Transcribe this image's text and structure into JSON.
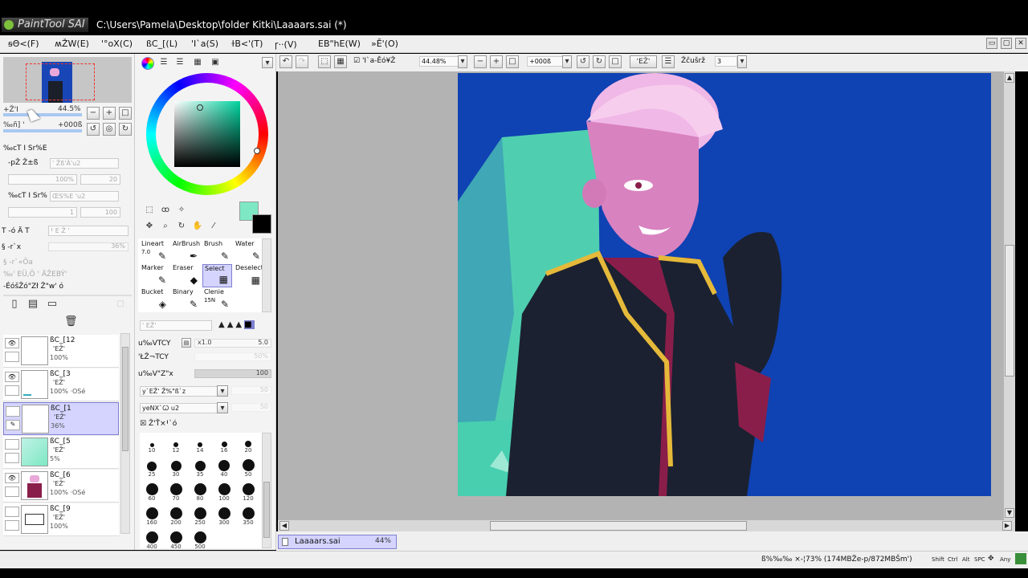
{
  "app": {
    "logo_text": "PaintTool SAI",
    "window_title": "C:\\Users\\Pamela\\Desktop\\folder Kitki\\Laaaars.sai (*)"
  },
  "menu": {
    "items": [
      "ꞩΘ<(F)",
      "ʍŽW(E)",
      "ꞌ°oX(C)",
      "ßC_[(L)",
      "ꞌI`a(S)",
      "ɫB<ꞌ(T)",
      "ꞅ··(V)",
      "EB\"hE(W)",
      "»Ӗꞌ(O)"
    ],
    "win_buttons": [
      "▭",
      "▢",
      "✕"
    ]
  },
  "navigator": {
    "zoom_label": "+ŽꞌI",
    "zoom_value": "44.5%",
    "angle_label": "‰ñ] ꞌ",
    "angle_value": "+000ß"
  },
  "layer_props": {
    "section1": "‰cT I Sr%E",
    "mode_label": "-pŽ Ž±ß",
    "mode_value": "ꞌ ŽßꞌÄꞌu2",
    "opacity_value": "100%",
    "val20": "20",
    "section2": "‰cT I Sr%",
    "mode2_value": "ŒS%E ꞌu2",
    "val1": "1",
    "val100": "100",
    "texture_label": "T -ó Ä T",
    "texture_value": "Ꞌ E Ž ꞌ",
    "tex_small": "§ -r`x",
    "tex_pct": "36%",
    "cb1": "§ -r`«Öa",
    "cb2": "‰ꞌ EÜ,Ö ꞌ ÄŽEBÝꞌ",
    "cb3": "-ÉóšŽó\"Zł Ž\"wꞌ ó"
  },
  "layers": [
    {
      "name": "ßC_[12",
      "mode": "ꞌEŽꞌ",
      "opacity": "100%",
      "visible": "true"
    },
    {
      "name": "ßC_[3",
      "mode": "ꞌEŽꞌ",
      "opacity": "100% ·OSé",
      "visible": "true"
    },
    {
      "name": "ßC_[1",
      "mode": "ꞌEŽꞌ",
      "opacity": "36%",
      "visible": "false"
    },
    {
      "name": "ßC_[5",
      "mode": "ꞌEŽꞌ",
      "opacity": "5%",
      "visible": "false"
    },
    {
      "name": "ßC_[6",
      "mode": "ꞌEŽꞌ",
      "opacity": "100% ·OSé",
      "visible": "true"
    },
    {
      "name": "ßC_[9",
      "mode": "ꞌEŽꞌ",
      "opacity": "100%",
      "visible": "false"
    }
  ],
  "colors": {
    "primary": "#7ee8c4",
    "secondary": "#000000",
    "accent": "#7f7fd0"
  },
  "tools": [
    {
      "label": "Lineart",
      "size": "7.0"
    },
    {
      "label": "AirBrush",
      "size": ""
    },
    {
      "label": "Brush",
      "size": ""
    },
    {
      "label": "Water",
      "size": ""
    },
    {
      "label": "Marker",
      "size": ""
    },
    {
      "label": "Eraser",
      "size": ""
    },
    {
      "label": "Select",
      "size": ""
    },
    {
      "label": "Deselect",
      "size": ""
    },
    {
      "label": "Bucket",
      "size": ""
    },
    {
      "label": "Binary",
      "size": ""
    },
    {
      "label": "Clenie",
      "size": "15N"
    }
  ],
  "brush_settings": {
    "mode_field": "ꞌ EŽꞌ",
    "size_label": "u‰VTCY",
    "size_mult": "x1.0",
    "size_value": "5.0",
    "min_label": "ꞌŁŽ¬TCY",
    "min_value": "50%",
    "density_label": "u‰V\"Z\"x",
    "density_value": "100",
    "shape1": "y`EŽꞌ Ž%\"ß`z",
    "shape1_val": "50",
    "shape2": "yeNX`Ꞷ u2",
    "shape2_val": "50",
    "adv_label": "ŽꞌŤ×Ꞌ`ó"
  },
  "brush_sizes": [
    {
      "s": "10",
      "d": 5
    },
    {
      "s": "12",
      "d": 6
    },
    {
      "s": "14",
      "d": 6
    },
    {
      "s": "16",
      "d": 7
    },
    {
      "s": "20",
      "d": 8
    },
    {
      "s": "25",
      "d": 12
    },
    {
      "s": "30",
      "d": 13
    },
    {
      "s": "35",
      "d": 13
    },
    {
      "s": "40",
      "d": 14
    },
    {
      "s": "50",
      "d": 15
    },
    {
      "s": "60",
      "d": 15
    },
    {
      "s": "70",
      "d": 15
    },
    {
      "s": "80",
      "d": 15
    },
    {
      "s": "100",
      "d": 15
    },
    {
      "s": "120",
      "d": 15
    },
    {
      "s": "160",
      "d": 15
    },
    {
      "s": "200",
      "d": 15
    },
    {
      "s": "250",
      "d": 15
    },
    {
      "s": "300",
      "d": 15
    },
    {
      "s": "350",
      "d": 15
    },
    {
      "s": "400",
      "d": 15
    },
    {
      "s": "450",
      "d": 15
    },
    {
      "s": "500",
      "d": 15
    }
  ],
  "toolbar": {
    "sel_label": "ꞌI`a-Ěó¥Ž",
    "zoom": "44.48%",
    "angle": "+000ß",
    "mode_label": "ꞌEŽꞌ",
    "stab_label": "Žčušrž",
    "stab_value": "3"
  },
  "document": {
    "tab_name": "Laaaars.sai",
    "tab_zoom": "44%"
  },
  "status": {
    "memory": "ß%‰‰ ×-¦73% (174MBŽe-p/872MBŠmꞌ)",
    "keys": [
      "Shift",
      "Ctrl",
      "Alt",
      "SPC",
      "Any"
    ]
  }
}
